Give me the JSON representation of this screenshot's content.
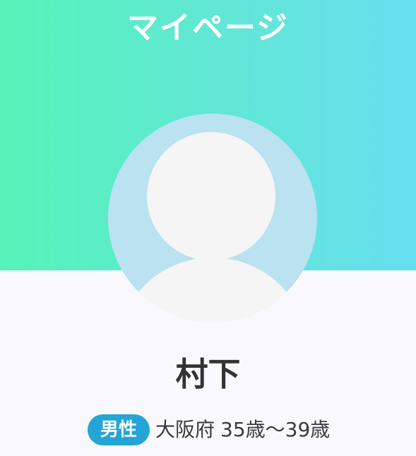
{
  "header": {
    "title": "マイページ"
  },
  "profile": {
    "name": "村下",
    "gender": "男性",
    "prefecture": "大阪府",
    "age_range": "35歳〜39歳"
  },
  "icons": {
    "avatar": "default-user-avatar-icon"
  },
  "colors": {
    "header_gradient_start": "#55f4b8",
    "header_gradient_end": "#66dff0",
    "avatar_background": "#bae2f1",
    "avatar_figure": "#f5f5f5",
    "gender_badge": "#24a5d6",
    "page_background": "#f9f9fd"
  }
}
